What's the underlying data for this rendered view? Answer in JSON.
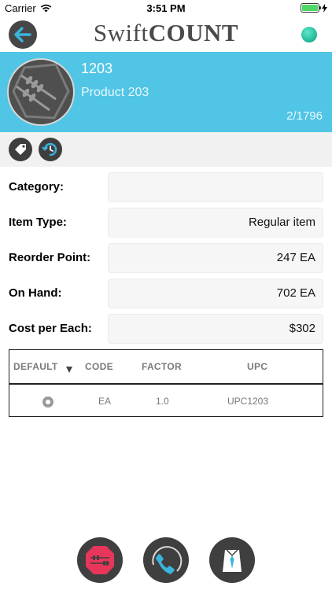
{
  "status_bar": {
    "carrier": "Carrier",
    "time": "3:51 PM"
  },
  "header": {
    "logo_light": "Swift",
    "logo_bold": "COUNT"
  },
  "product": {
    "code": "1203",
    "name": "Product 203",
    "counter": "2/1796"
  },
  "form": {
    "category": {
      "label": "Category:",
      "value": ""
    },
    "item_type": {
      "label": "Item Type:",
      "value": "Regular item"
    },
    "reorder_point": {
      "label": "Reorder Point:",
      "value": "247 EA"
    },
    "on_hand": {
      "label": "On Hand:",
      "value": "702 EA"
    },
    "cost": {
      "label": "Cost per Each:",
      "value": "$302"
    }
  },
  "uom_table": {
    "headers": {
      "default": "DEFAULT",
      "code": "CODE",
      "factor": "FACTOR",
      "upc": "UPC"
    },
    "rows": [
      {
        "code": "EA",
        "factor": "1.0",
        "upc": "UPC1203"
      }
    ]
  },
  "colors": {
    "banner": "#50c5e5",
    "status_dot": "#1fb596",
    "dark_icon": "#3f3f3f",
    "accent_blue": "#3ab3dd"
  }
}
